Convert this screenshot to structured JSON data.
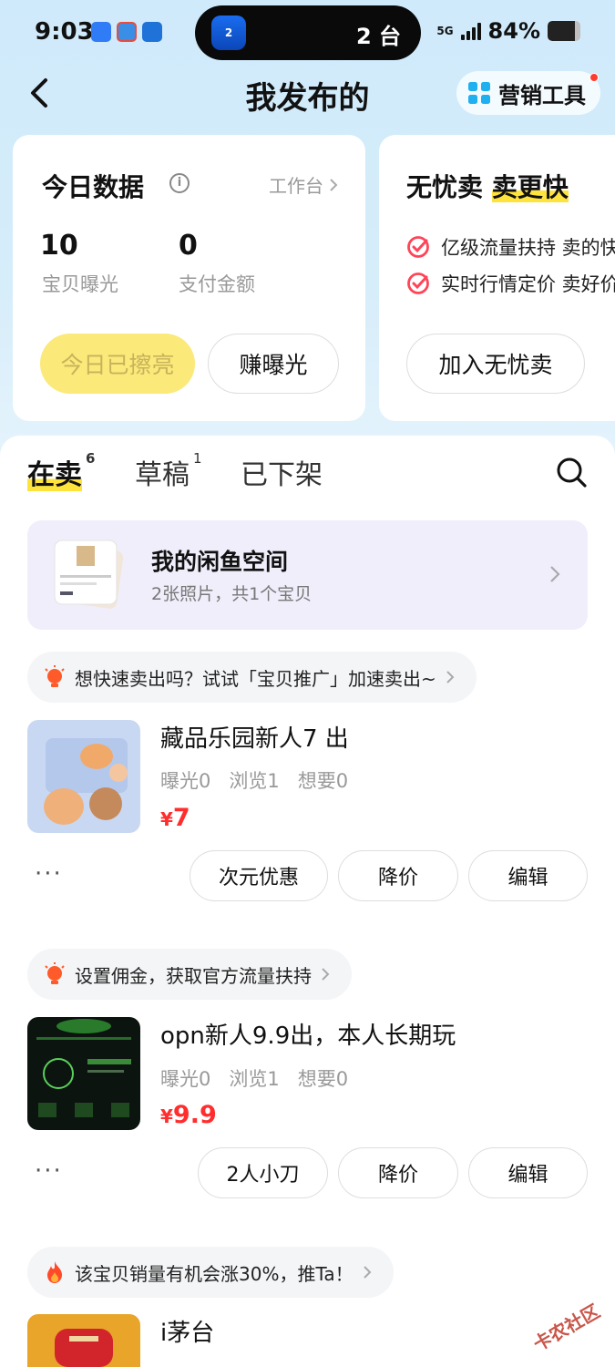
{
  "status_bar": {
    "time": "9:03",
    "island_text": "2 台",
    "island_badge": "2",
    "network": "5G",
    "battery": "84%",
    "battery_level": 0.84
  },
  "header": {
    "title": "我发布的",
    "marketing_tool": "营销工具"
  },
  "today_card": {
    "title": "今日数据",
    "link": "工作台",
    "stats": [
      {
        "value": "10",
        "label": "宝贝曝光"
      },
      {
        "value": "0",
        "label": "支付金额"
      }
    ],
    "polished_button": "今日已擦亮",
    "earn_button": "赚曝光"
  },
  "worry_free_card": {
    "title_plain": "无忧卖",
    "title_highlight": "卖更快",
    "features": [
      "亿级流量扶持 卖的快",
      "实时行情定价 卖好价"
    ],
    "join_button": "加入无忧卖"
  },
  "tabs": [
    {
      "label": "在卖",
      "count": "6"
    },
    {
      "label": "草稿",
      "count": "1"
    },
    {
      "label": "已下架",
      "count": ""
    }
  ],
  "space_card": {
    "title": "我的闲鱼空间",
    "subtitle": "2张照片，共1个宝贝"
  },
  "items": [
    {
      "tip": "想快速卖出吗？试试「宝贝推广」加速卖出~",
      "title": "藏品乐园新人7 出",
      "stats": [
        "曝光0",
        "浏览1",
        "想要0"
      ],
      "currency": "¥",
      "price": "7",
      "actions": [
        "次元优惠",
        "降价",
        "编辑"
      ]
    },
    {
      "tip": "设置佣金，获取官方流量扶持",
      "title": "opn新人9.9出，本人长期玩",
      "stats": [
        "曝光0",
        "浏览1",
        "想要0"
      ],
      "currency": "¥",
      "price": "9.9",
      "actions": [
        "2人小刀",
        "降价",
        "编辑"
      ]
    },
    {
      "tip": "该宝贝销量有机会涨30%，推Ta！",
      "title": "i茅台"
    }
  ],
  "more_dots": "···",
  "watermark": "卡农社区",
  "colors": {
    "accent_yellow": "#ffe33d",
    "price_red": "#ff2d2d",
    "bg_blue": "#d8eefa"
  }
}
